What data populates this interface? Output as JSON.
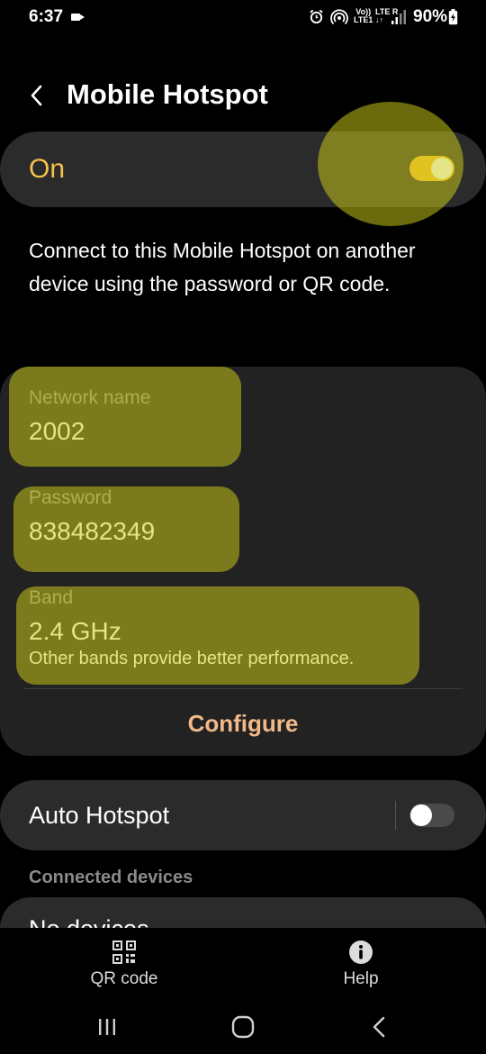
{
  "status_bar": {
    "time": "6:37",
    "volte_line1": "Vo))",
    "volte_line2": "LTE1",
    "lte_line1": "LTE R",
    "lte_line2": "↓↑",
    "battery": "90%"
  },
  "header": {
    "title": "Mobile Hotspot"
  },
  "master_switch": {
    "label": "On",
    "state": "on",
    "accent_color": "#f6b62a"
  },
  "description": "Connect to this Mobile Hotspot on another device using the password or QR code.",
  "network": {
    "name_label": "Network name",
    "name_value": "2002",
    "password_label": "Password",
    "password_value": "838482349",
    "band_label": "Band",
    "band_value": "2.4 GHz",
    "band_note": "Other bands provide better performance.",
    "configure_label": "Configure"
  },
  "auto_hotspot": {
    "label": "Auto Hotspot",
    "state": "off"
  },
  "connected_devices": {
    "header": "Connected devices",
    "empty_text": "No devices"
  },
  "toolbar": {
    "qr_label": "QR code",
    "help_label": "Help"
  },
  "icons": {
    "back": "back-arrow-icon",
    "qr": "qr-code-icon",
    "help": "info-icon",
    "nav_recent": "recent-apps-icon",
    "nav_home": "home-icon",
    "nav_back": "nav-back-icon"
  },
  "highlight_color": "#cdcd19"
}
